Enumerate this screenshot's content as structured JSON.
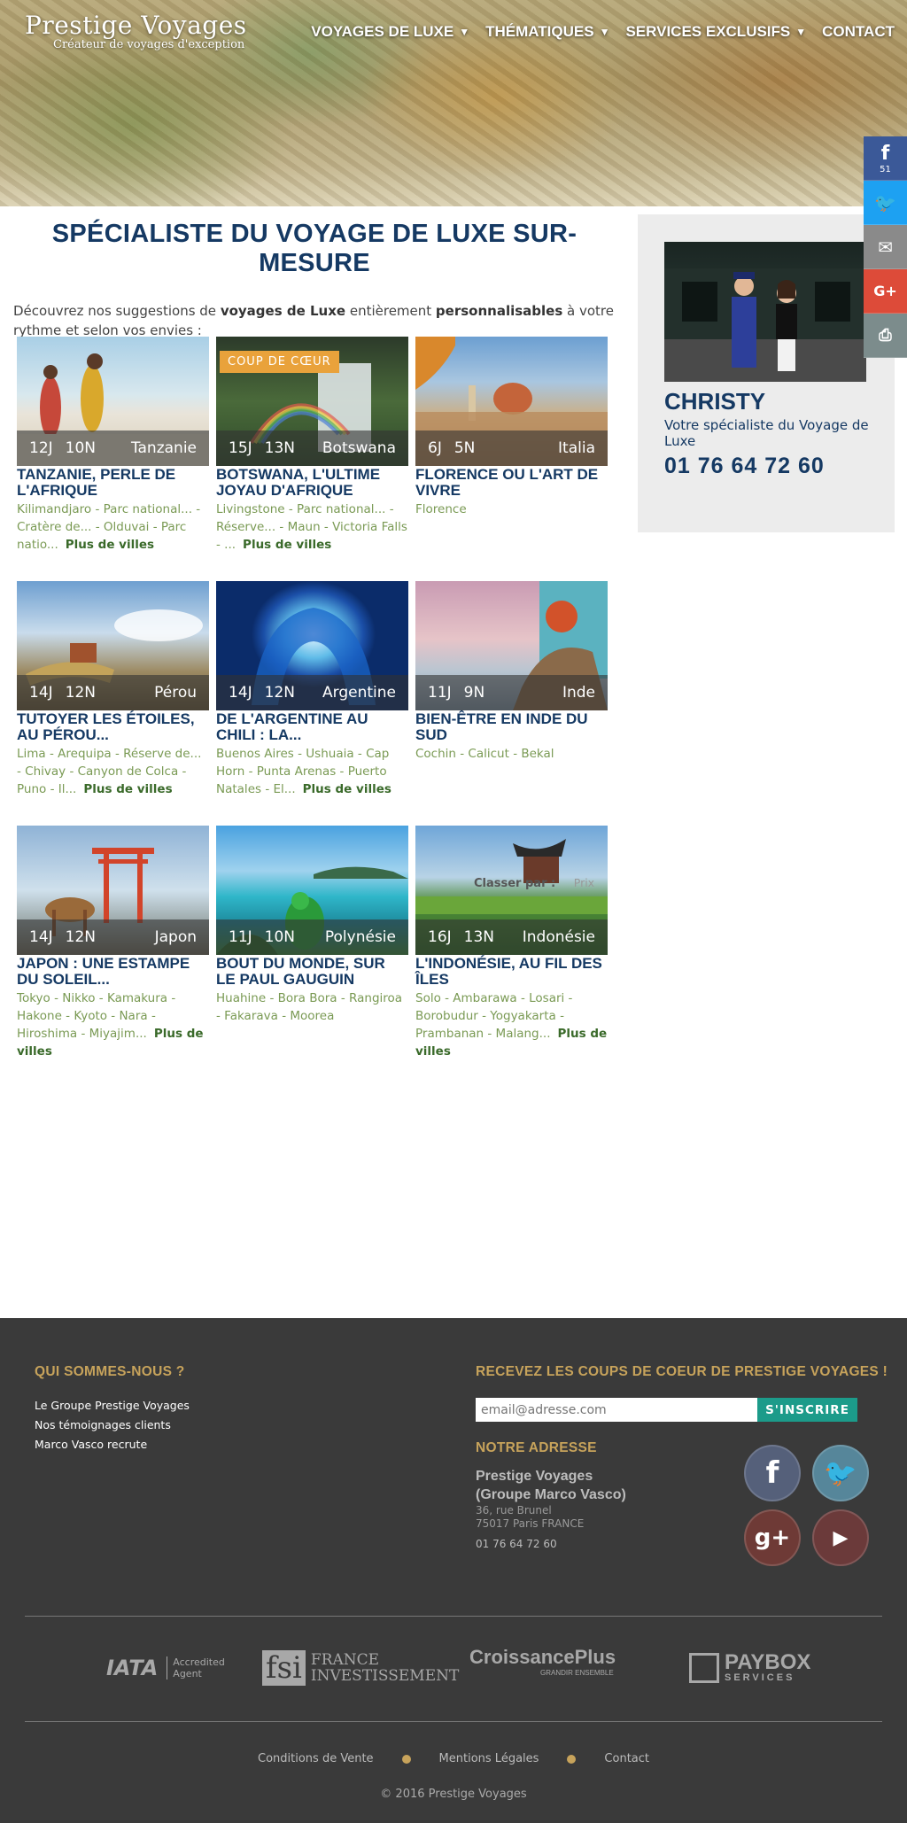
{
  "header": {
    "logo_title": "Prestige Voyages",
    "logo_subtitle": "Créateur de voyages d'exception",
    "nav": [
      {
        "label": "VOYAGES DE LUXE",
        "has_caret": true
      },
      {
        "label": "THÉMATIQUES",
        "has_caret": true
      },
      {
        "label": "SERVICES EXCLUSIFS",
        "has_caret": true
      },
      {
        "label": "CONTACT",
        "has_caret": false
      }
    ],
    "caret_glyph": "▼"
  },
  "share_bar": {
    "facebook_icon": "f",
    "facebook_count": "51",
    "twitter_icon": "🐦",
    "mail_icon": "✉",
    "googleplus_icon": "G+",
    "print_icon": "⎙"
  },
  "main": {
    "title": "SPÉCIALISTE DU VOYAGE DE LUXE SUR-MESURE",
    "intro_1": "Découvrez nos suggestions de ",
    "intro_bold_1": "voyages de Luxe",
    "intro_2": " entièrement ",
    "intro_bold_2": "personnalisables",
    "intro_3": " à votre rythme et selon vos envies :"
  },
  "cards": [
    {
      "days": "12J",
      "nights": "10N",
      "country": "Tanzanie",
      "title": "TANZANIE, PERLE DE L'AFRIQUE",
      "cities": "Kilimandjaro - Parc national... - Cratère de... - Olduvai - Parc natio...",
      "more": "Plus de villes",
      "badge": ""
    },
    {
      "days": "15J",
      "nights": "13N",
      "country": "Botswana",
      "title": "BOTSWANA, L'ULTIME JOYAU D'AFRIQUE",
      "cities": "Livingstone - Parc national... - Réserve... - Maun - Victoria Falls - ...",
      "more": "Plus de villes",
      "badge": "COUP DE CŒUR"
    },
    {
      "days": "6J",
      "nights": "5N",
      "country": "Italia",
      "title": "FLORENCE OU L'ART DE VIVRE",
      "cities": "Florence",
      "more": "",
      "badge": ""
    },
    {
      "days": "14J",
      "nights": "12N",
      "country": "Pérou",
      "title": "TUTOYER LES ÉTOILES, AU PÉROU...",
      "cities": "Lima - Arequipa - Réserve de... - Chivay - Canyon de Colca - Puno - Il...",
      "more": "Plus de villes",
      "badge": ""
    },
    {
      "days": "14J",
      "nights": "12N",
      "country": "Argentine",
      "title": "DE L'ARGENTINE AU CHILI : LA...",
      "cities": "Buenos Aires - Ushuaia - Cap Horn - Punta Arenas - Puerto Natales - El...",
      "more": "Plus de villes",
      "badge": ""
    },
    {
      "days": "11J",
      "nights": "9N",
      "country": "Inde",
      "title": "BIEN-ÊTRE EN INDE DU SUD",
      "cities": "Cochin - Calicut - Bekal",
      "more": "",
      "badge": ""
    },
    {
      "days": "14J",
      "nights": "12N",
      "country": "Japon",
      "title": "JAPON : UNE ESTAMPE DU SOLEIL...",
      "cities": "Tokyo - Nikko - Kamakura - Hakone - Kyoto - Nara - Hiroshima - Miyajim...",
      "more": "Plus de villes",
      "badge": ""
    },
    {
      "days": "11J",
      "nights": "10N",
      "country": "Polynésie",
      "title": "BOUT DU MONDE, SUR LE PAUL GAUGUIN",
      "cities": "Huahine - Bora Bora - Rangiroa - Fakarava - Moorea",
      "more": "",
      "badge": ""
    },
    {
      "days": "16J",
      "nights": "13N",
      "country": "Indonésie",
      "title": "L'INDONÉSIE, AU FIL DES ÎLES",
      "cities": "Solo - Ambarawa - Losari - Borobudur - Yogyakarta - Prambanan - Malang...",
      "more": "Plus de villes",
      "badge": ""
    }
  ],
  "sort": {
    "label": "Classer par :",
    "option": "Prix"
  },
  "advisor": {
    "name": "CHRISTY",
    "role": "Votre spécialiste du Voyage de Luxe",
    "phone": "01 76 64 72 60"
  },
  "footer": {
    "about_heading": "QUI SOMMES-NOUS ?",
    "about_links": [
      "Le Groupe Prestige Voyages",
      "Nos témoignages clients",
      "Marco Vasco recrute"
    ],
    "news_heading": "RECEVEZ LES COUPS DE COEUR DE PRESTIGE VOYAGES !",
    "news_placeholder": "email@adresse.com",
    "news_button": "S'INSCRIRE",
    "address_heading": "NOTRE ADRESSE",
    "address_name_1": "Prestige Voyages",
    "address_name_2": "(Groupe Marco Vasco)",
    "address_street": "36, rue Brunel",
    "address_city": "75017 Paris FRANCE",
    "address_phone": "01 76 64 72 60",
    "social": {
      "facebook": "f",
      "twitter": "🐦",
      "googleplus": "g+",
      "youtube": "▶"
    },
    "partners": {
      "iata": "IATA",
      "iata_sub_1": "Accredited",
      "iata_sub_2": "Agent",
      "fsi_box": "fsi",
      "fsi_1": "FRANCE",
      "fsi_2": "INVESTISSEMENT",
      "cp": "CroissancePlus",
      "cp_sub": "GRANDIR ENSEMBLE",
      "paybox": "PAYBOX",
      "paybox_sub": "SERVICES"
    },
    "bottom_links": [
      "Conditions de Vente",
      "Mentions Légales",
      "Contact"
    ],
    "copyright": "© 2016 Prestige Voyages"
  }
}
